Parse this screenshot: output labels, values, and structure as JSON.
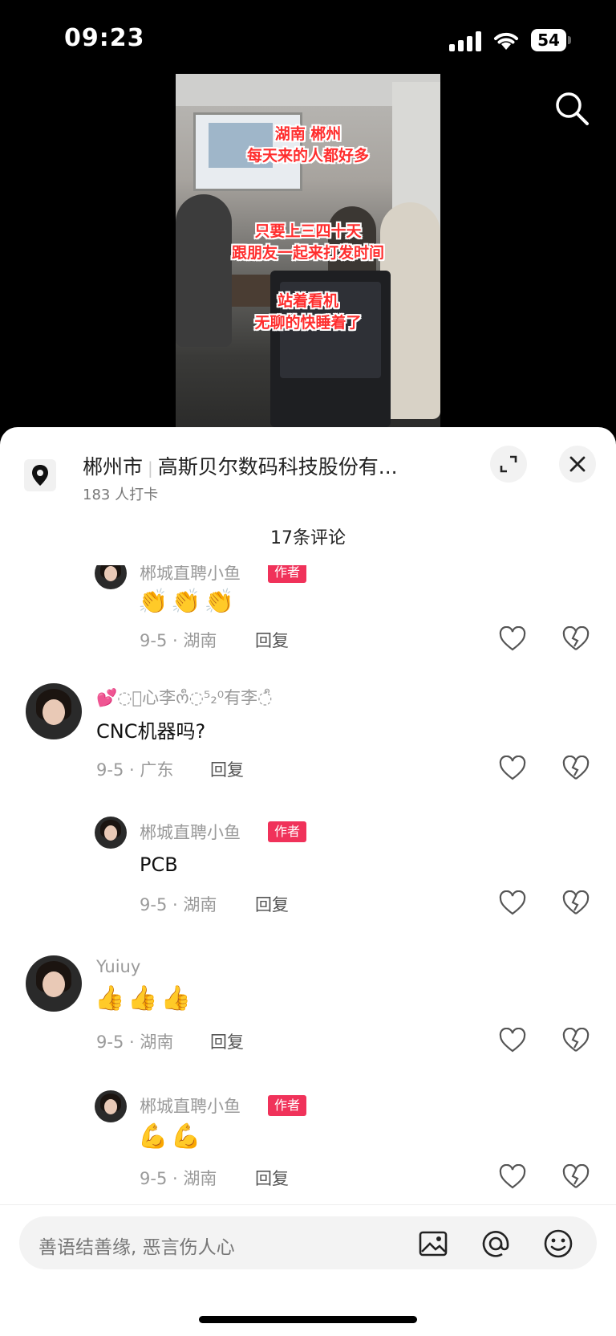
{
  "status_bar": {
    "time": "09:23",
    "battery": "54"
  },
  "video": {
    "overlay_lines": [
      "湖南 郴州",
      "每天来的人都好多",
      "只要上三四十天",
      "跟朋友一起来打发时间",
      "站着看机",
      "无聊的快睡着了"
    ]
  },
  "sheet": {
    "location_city": "郴州市",
    "location_place": "高斯贝尔数码科技股份有...",
    "location_checkins": "183 人打卡",
    "comment_count": "17条评论"
  },
  "comments": [
    {
      "name": "郴城直聘小鱼",
      "badge": "作者",
      "emoji": "👏👏👏",
      "date_region": "9-5 · 湖南",
      "reply": "回复"
    },
    {
      "name": "💕◌ᩧ心李ოᩧ◌⁵₂⁰有李◌ᩧ",
      "text": "CNC机器吗?",
      "date_region": "9-5 · 广东",
      "reply": "回复"
    },
    {
      "name": "郴城直聘小鱼",
      "badge": "作者",
      "text": "PCB",
      "date_region": "9-5 · 湖南",
      "reply": "回复"
    },
    {
      "name": "Yuiuy",
      "emoji": "👍👍👍",
      "date_region": "9-5 · 湖南",
      "reply": "回复"
    },
    {
      "name": "郴城直聘小鱼",
      "badge": "作者",
      "emoji": "💪💪",
      "date_region": "9-5 · 湖南",
      "reply": "回复"
    }
  ],
  "input_bar": {
    "placeholder": "善语结善缘, 恶言伤人心"
  },
  "icons": {
    "location": "location-pin-icon",
    "expand": "expand-icon",
    "close": "close-icon",
    "like": "heart-icon",
    "dislike": "broken-heart-icon",
    "image": "image-icon",
    "mention": "at-icon",
    "emoji": "emoji-icon",
    "search": "search-icon"
  },
  "colors": {
    "badge": "#f0325a",
    "overlay_text": "#ff2e2e"
  }
}
